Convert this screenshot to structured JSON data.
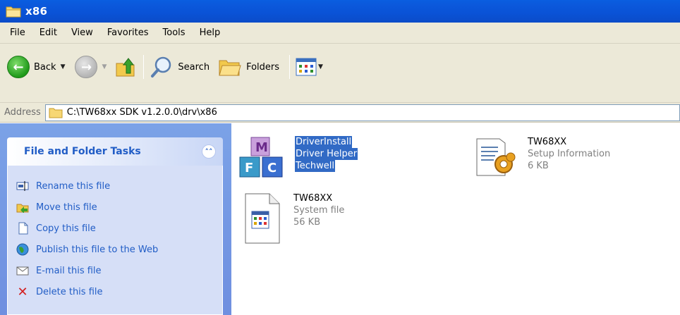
{
  "window": {
    "title": "x86"
  },
  "menu": [
    "File",
    "Edit",
    "View",
    "Favorites",
    "Tools",
    "Help"
  ],
  "toolbar": {
    "back": "Back",
    "search": "Search",
    "folders": "Folders"
  },
  "address": {
    "label": "Address",
    "path": "C:\\TW68xx SDK v1.2.0.0\\drv\\x86"
  },
  "tasks": {
    "header": "File and Folder Tasks",
    "collapse_glyph": "˄˄",
    "items": [
      {
        "label": "Rename this file",
        "icon": "rename-icon"
      },
      {
        "label": "Move this file",
        "icon": "move-icon"
      },
      {
        "label": "Copy this file",
        "icon": "copy-icon"
      },
      {
        "label": "Publish this file to the Web",
        "icon": "web-publish-icon"
      },
      {
        "label": "E-mail this file",
        "icon": "email-icon"
      },
      {
        "label": "Delete this file",
        "icon": "delete-icon"
      }
    ]
  },
  "files": [
    {
      "name": "DriverInstall",
      "line2": "Driver Helper",
      "line3": "Techwell",
      "selected": true,
      "icon": "mfc-app-icon"
    },
    {
      "name": "TW68XX",
      "line2": "Setup Information",
      "line3": "6 KB",
      "selected": false,
      "icon": "setup-info-icon"
    },
    {
      "name": "TW68XX",
      "line2": "System file",
      "line3": "56 KB",
      "selected": false,
      "icon": "system-file-icon"
    }
  ],
  "colors": {
    "titlebar": "#0a52d6",
    "selection": "#316ac5",
    "task_link": "#215dc6",
    "taskpane_bg": "#7ba2e7"
  }
}
